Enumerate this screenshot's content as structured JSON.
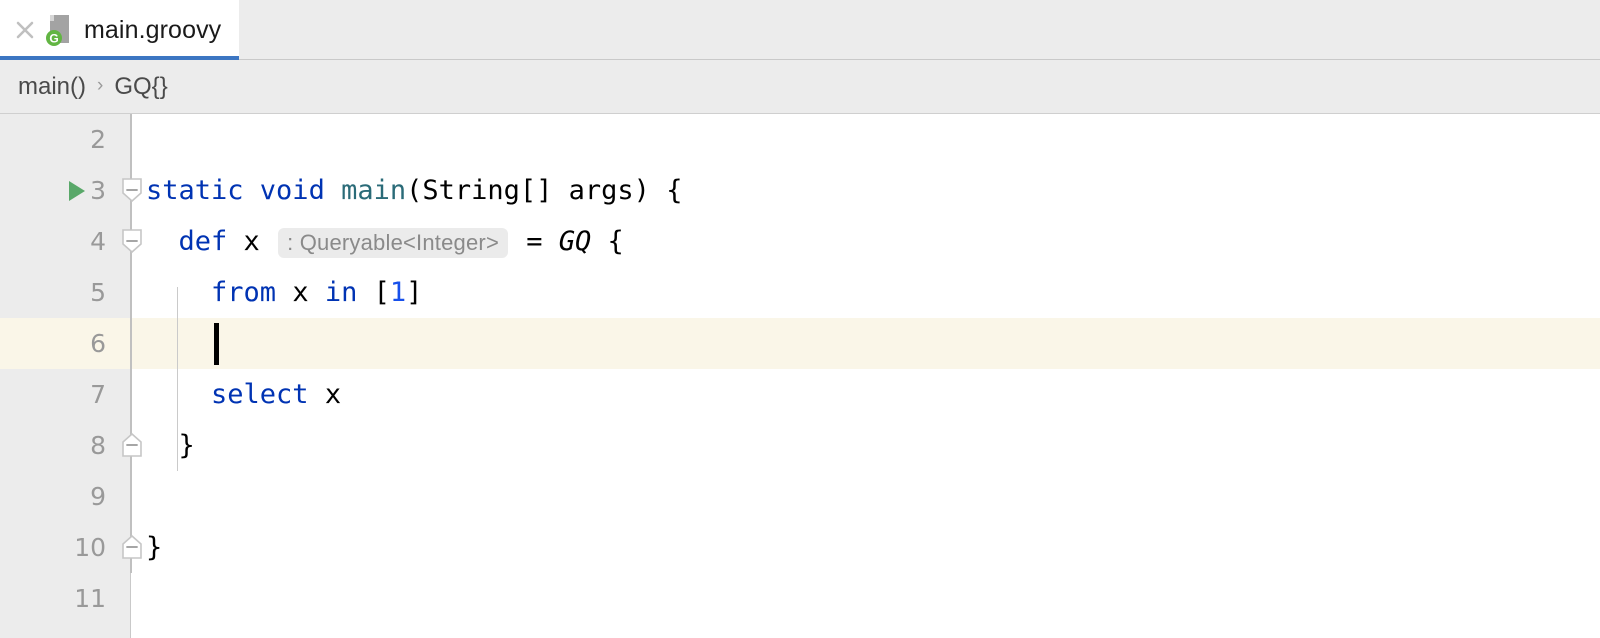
{
  "tab": {
    "title": "main.groovy",
    "close_icon": "close-icon",
    "file_icon": "groovy-file-icon",
    "file_icon_badge": "G",
    "underline_color": "#3c76c2",
    "active": true
  },
  "breadcrumb": {
    "separator": "›",
    "items": [
      {
        "label": "main()"
      },
      {
        "label": "GQ{}"
      }
    ]
  },
  "editor": {
    "background": "#ffffff",
    "gutter_background": "#ececec",
    "current_line_color": "#faf6e8",
    "current_line_number": 6,
    "caret": {
      "line": 6,
      "column": 5
    },
    "run_marker_line": 3,
    "colors": {
      "keyword": "#0033b3",
      "method": "#2a6b78",
      "number": "#1750eb",
      "text": "#000000",
      "inlay_hint_text": "#8a8a8a",
      "inlay_hint_background": "#ebebeb",
      "line_number": "#999999",
      "run_icon": "#59a869"
    },
    "lines": [
      {
        "number": "2",
        "tokens": [],
        "fold": null,
        "run": false,
        "current": false
      },
      {
        "number": "3",
        "tokens": [
          {
            "t": "static ",
            "k": "kw"
          },
          {
            "t": "void ",
            "k": "kw"
          },
          {
            "t": "main",
            "k": "fn"
          },
          {
            "t": "(String[] args) {",
            "k": "plain"
          }
        ],
        "fold": "collapse",
        "run": true,
        "current": false
      },
      {
        "number": "4",
        "tokens": [
          {
            "t": "  ",
            "k": "plain"
          },
          {
            "t": "def",
            "k": "kw"
          },
          {
            "t": " x ",
            "k": "plain"
          },
          {
            "t": ": Queryable<Integer>",
            "k": "hint"
          },
          {
            "t": " = ",
            "k": "plain"
          },
          {
            "t": "GQ",
            "k": "ital"
          },
          {
            "t": " {",
            "k": "plain"
          }
        ],
        "fold": "collapse",
        "run": false,
        "current": false
      },
      {
        "number": "5",
        "tokens": [
          {
            "t": "    ",
            "k": "plain"
          },
          {
            "t": "from",
            "k": "kw"
          },
          {
            "t": " x ",
            "k": "plain"
          },
          {
            "t": "in",
            "k": "kw"
          },
          {
            "t": " [",
            "k": "plain"
          },
          {
            "t": "1",
            "k": "num"
          },
          {
            "t": "]",
            "k": "plain"
          }
        ],
        "fold": null,
        "run": false,
        "current": false
      },
      {
        "number": "6",
        "tokens": [],
        "fold": null,
        "run": false,
        "current": true
      },
      {
        "number": "7",
        "tokens": [
          {
            "t": "    ",
            "k": "plain"
          },
          {
            "t": "select",
            "k": "kw"
          },
          {
            "t": " x",
            "k": "plain"
          }
        ],
        "fold": null,
        "run": false,
        "current": false
      },
      {
        "number": "8",
        "tokens": [
          {
            "t": "  }",
            "k": "plain"
          }
        ],
        "fold": "expand",
        "run": false,
        "current": false
      },
      {
        "number": "9",
        "tokens": [],
        "fold": null,
        "run": false,
        "current": false
      },
      {
        "number": "10",
        "tokens": [
          {
            "t": "}",
            "k": "plain"
          }
        ],
        "fold": "expand",
        "run": false,
        "current": false
      },
      {
        "number": "11",
        "tokens": [],
        "fold": null,
        "run": false,
        "current": false
      }
    ]
  }
}
